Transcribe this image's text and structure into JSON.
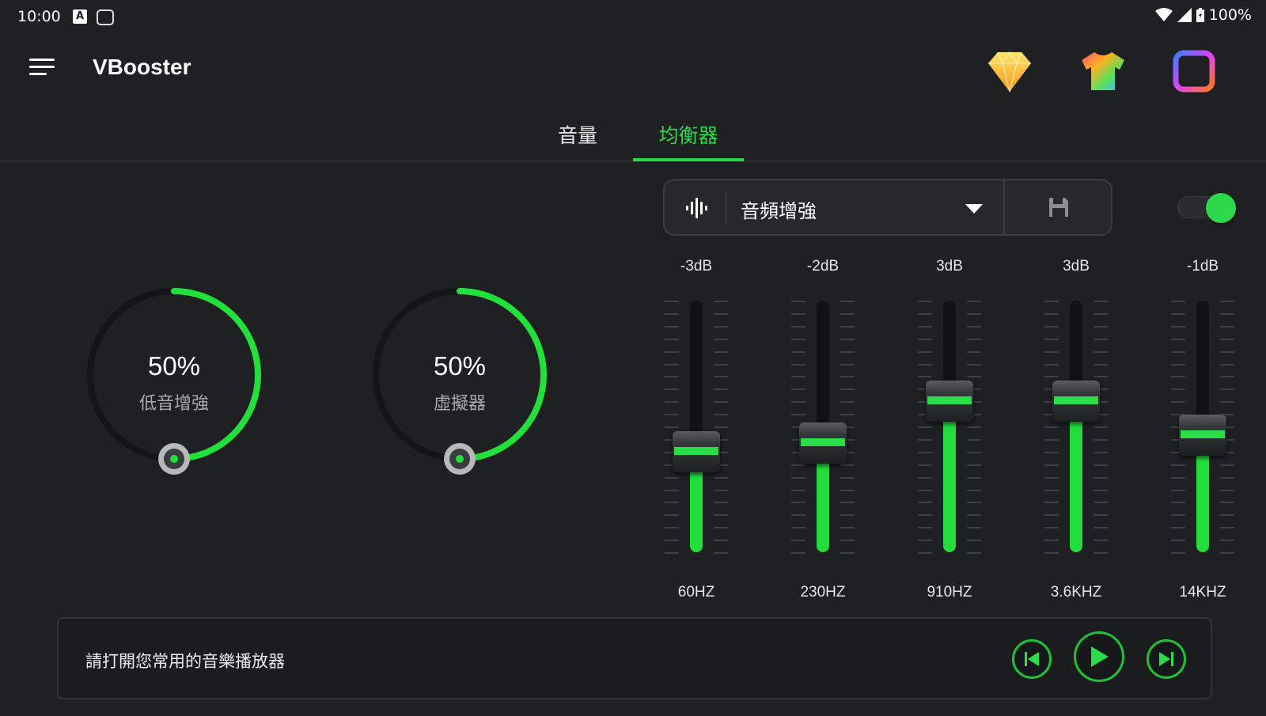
{
  "status_bar": {
    "time": "10:00",
    "battery": "100%",
    "icons": [
      "keyboard-a-icon",
      "app-notification-icon",
      "wifi-icon",
      "signal-icon",
      "battery-icon"
    ]
  },
  "app_bar": {
    "title": "VBooster",
    "icons": [
      "menu-icon",
      "diamond-icon",
      "shirt-icon",
      "frame-icon"
    ]
  },
  "tabs": [
    {
      "label": "音量",
      "active": false
    },
    {
      "label": "均衡器",
      "active": true
    }
  ],
  "colors": {
    "accent": "#2bd94a",
    "background": "#1e2022"
  },
  "dials": {
    "bass": {
      "value": "50%",
      "label": "低音增強",
      "fraction": 0.5
    },
    "virtualizer": {
      "value": "50%",
      "label": "虛擬器",
      "fraction": 0.5
    }
  },
  "preset": {
    "name": "音頻增強",
    "icons": [
      "soundwave-icon",
      "dropdown-arrow-icon",
      "save-icon"
    ]
  },
  "eq_enabled": true,
  "equalizer": {
    "bands": [
      {
        "db": "-3dB",
        "freq": "60HZ",
        "value": -3
      },
      {
        "db": "-2dB",
        "freq": "230HZ",
        "value": -2
      },
      {
        "db": "3dB",
        "freq": "910HZ",
        "value": 3
      },
      {
        "db": "3dB",
        "freq": "3.6KHZ",
        "value": 3
      },
      {
        "db": "-1dB",
        "freq": "14KHZ",
        "value": -1
      }
    ]
  },
  "player": {
    "message": "請打開您常用的音樂播放器",
    "icons": [
      "previous-icon",
      "play-icon",
      "next-icon"
    ]
  }
}
